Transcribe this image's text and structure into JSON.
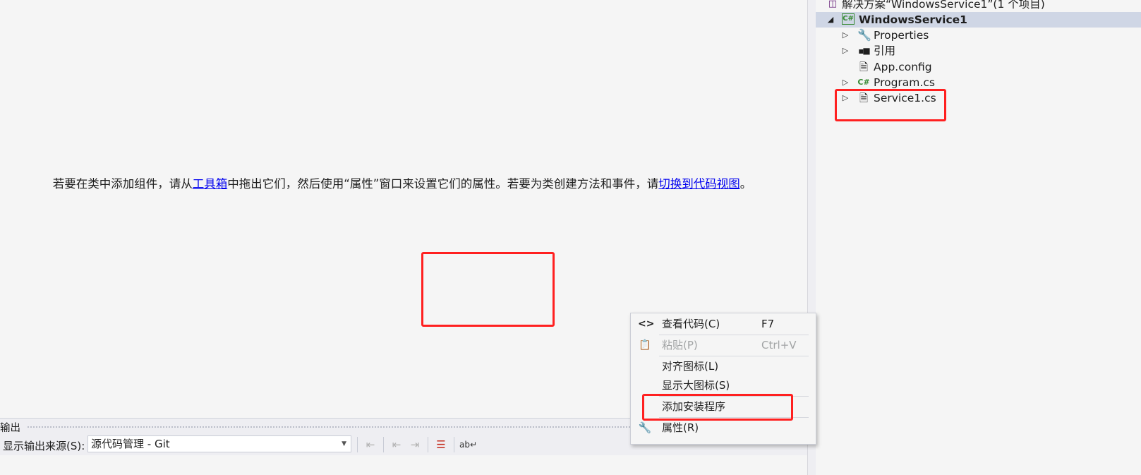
{
  "designer": {
    "hint_before": "若要在类中添加组件，请从",
    "toolbox_link": "工具箱",
    "hint_middle": "中拖出它们，然后使用“属性”窗口来设置它们的属性。若要为类创建方法和事件，请",
    "switch_link": "切换到代码视图",
    "hint_after": "。"
  },
  "solution_explorer": {
    "solution_label": "解决方案“WindowsService1”(1 个项目)",
    "project": "WindowsService1",
    "items": [
      {
        "label": "Properties",
        "icon": "wrench-icon"
      },
      {
        "label": "引用",
        "icon": "references-icon"
      },
      {
        "label": "App.config",
        "icon": "config-file-icon"
      },
      {
        "label": "Program.cs",
        "icon": "csharp-file-icon"
      },
      {
        "label": "Service1.cs",
        "icon": "service-file-icon"
      }
    ]
  },
  "output": {
    "title": "输出",
    "source_label": "显示输出来源(S):",
    "source_value": "源代码管理 - Git"
  },
  "context_menu": {
    "items": [
      {
        "label": "查看代码(C)",
        "shortcut": "F7",
        "icon": "code-brackets-icon",
        "enabled": true
      },
      {
        "label": "粘贴(P)",
        "shortcut": "Ctrl+V",
        "icon": "paste-icon",
        "enabled": false
      },
      {
        "label": "对齐图标(L)",
        "shortcut": "",
        "icon": "",
        "enabled": true
      },
      {
        "label": "显示大图标(S)",
        "shortcut": "",
        "icon": "",
        "enabled": true
      },
      {
        "label": "添加安装程序",
        "shortcut": "",
        "icon": "",
        "enabled": true
      },
      {
        "label": "属性(R)",
        "shortcut": "",
        "icon": "wrench-icon",
        "enabled": true
      }
    ]
  },
  "colors": {
    "highlight_red": "#ff2020",
    "link_blue": "#0000ee",
    "selected_row": "#cfd6e5",
    "csharp_green": "#388a34"
  }
}
